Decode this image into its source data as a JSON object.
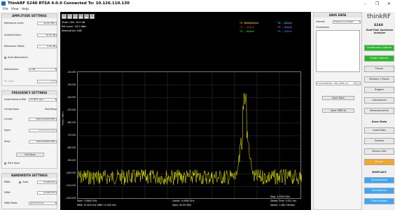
{
  "window": {
    "title": "ThinkRF S240 RTSA 4.0.0  Connected To: 10.126.110.130",
    "controls": [
      "–",
      "❐",
      "✕"
    ]
  },
  "menu": [
    "File",
    "View",
    "Help"
  ],
  "amplitude": {
    "header": "AMPLITUDE SETTINGS",
    "ref_level_label": "Reference Level:",
    "ref_level_value": "-20.00 dBm",
    "scale_label": "Scale/Division:",
    "scale_value": "10.00 dB",
    "ref_offset_label": "Reference Offset:",
    "ref_offset_value": "0.00 dB",
    "auto_atten_label": "Auto Attenuation",
    "atten_label": "Attenuation:",
    "atten_value": "0 dB",
    "rf_gain_label": "RF Gain:",
    "rf_gain_value": "0 dB"
  },
  "frequency": {
    "header": "FREQUENCY SETTINGS",
    "ibw_label": "Instantaneous BW:",
    "ibw_value": "10 MHz span",
    "center_span_label": "Center/Span",
    "start_stop_label": "Start/Stop",
    "center_label": "Center:",
    "center_value": "4000.000000 MHz",
    "span_label": "Span:",
    "span_value": "40.000000 MHz",
    "step_label": "Step:",
    "step_value": "1000.000000 MHz",
    "full_span_label": "Full Span",
    "zero_span_label": "Zero Span"
  },
  "bandwidth": {
    "header": "BANDWIDTH SETTINGS",
    "rbw_label": "RBW:",
    "rbw_mode": "Auto",
    "rbw_value": "10.000 kHz",
    "vbw_label": "VBW:",
    "vbw_value": "10.000 kHz",
    "vbw_mode_label": "VBW Mode:",
    "vbw_mode_value": "Synchronous"
  },
  "display": {
    "toolbar": [
      "M",
      "F1",
      "F2",
      "F3",
      "F4",
      "⚙"
    ],
    "info_lines": [
      "Scale / Div: 10.0 dB",
      "Ref Level: -20.0 dBm",
      "Attenuation: 0dB"
    ],
    "trace_lines": [
      {
        "text": "T1: Write/Active",
        "color": "#ffff33"
      },
      {
        "text": "T2: ---/Blank",
        "color": "#ff3333"
      },
      {
        "text": "T3: ---/Blank",
        "color": "#33ff33"
      }
    ],
    "trace_lines_right": [
      {
        "text": "T4: ---/Blank",
        "color": "#33ffff"
      },
      {
        "text": "T5: ---/Blank",
        "color": "#ff66ff"
      },
      {
        "text": "T6: ---/Blank",
        "color": "#3399ff"
      }
    ],
    "y_axis_name": "Power (dBm)",
    "y_ticks": [
      "-20.00",
      "-30.00",
      "-40.00",
      "-50.00",
      "-60.00",
      "-70.00",
      "-80.00",
      "-90.00",
      "-100.00",
      "-110.00",
      "-120.00"
    ],
    "footer_left": [
      "Start: 3.9800 GHz",
      "RBW: 10.000 kHz  VBW: 10.000 kHz"
    ],
    "footer_center": [
      "Center: 4.0000 GHz",
      "Span: 40.00 MHz"
    ],
    "footer_right": [
      "Stop: 4.0200 GHz",
      "Sweep Time: 0.001 Sec",
      "Speed: 1.280 GHz/sec"
    ],
    "trace_color": "#ffff00",
    "grid_color": "#444444"
  },
  "save": {
    "header": "SAVE DATA",
    "format_label": "Format:",
    "format_value": "Frequency Domain",
    "comments_label": "Comments:",
    "path_value": "C:/Users/Temp/...MO_1544.csv",
    "save_btn": "Save Data",
    "save_obw_btn": "Save OBW to"
  },
  "right": {
    "brand": "thinkRF",
    "model": "S240",
    "subtitle": "Real-Time Spectrum Analyzer",
    "continuous_capture": "Continuous Capture",
    "single_capture": "Single Capture",
    "traces": "Traces",
    "markers_peaks": "Markers / Peaks",
    "triggers": "Triggers",
    "corrections": "Corrections",
    "measurements": "Measurements",
    "save_data": "Save Data",
    "load_data": "Load Data",
    "system": "System",
    "device_info": "Device Info",
    "preset": "Preset",
    "displays_label": "DISPLAYS",
    "spectrogram": "Spectrogram",
    "persistence": "Persistence",
    "time_domain": "Time Domain"
  }
}
